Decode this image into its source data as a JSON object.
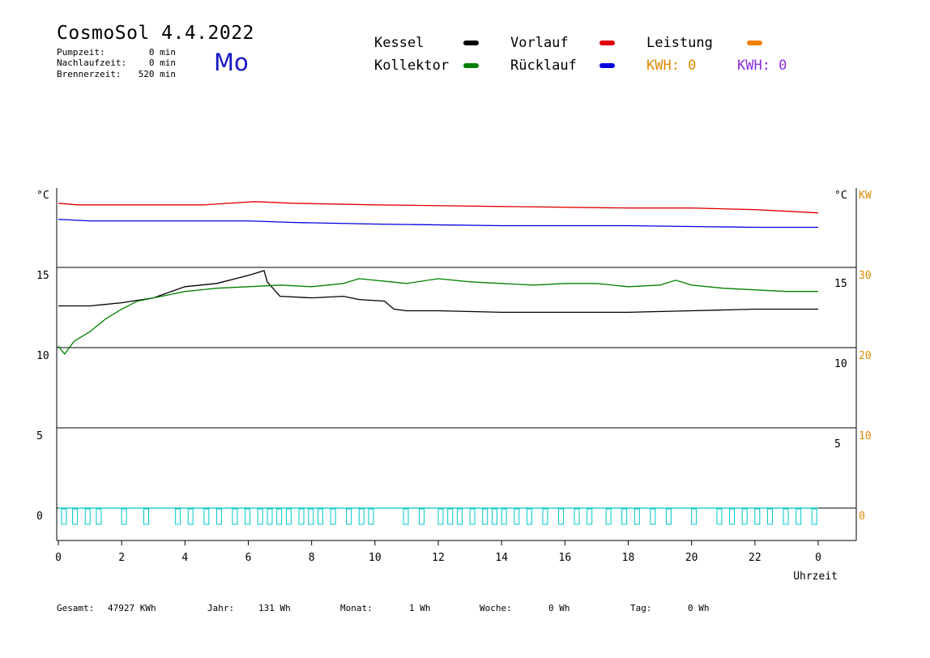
{
  "header": {
    "title": "CosmoSol 4.4.2022",
    "day": "Mo",
    "info": [
      {
        "label": "Pumpzeit:",
        "value": "0 min"
      },
      {
        "label": "Nachlaufzeit:",
        "value": "0 min"
      },
      {
        "label": "Brennerzeit:",
        "value": "520 min"
      }
    ]
  },
  "legend": {
    "items": [
      {
        "label": "Kessel",
        "color": "#000000"
      },
      {
        "label": "Vorlauf",
        "color": "#e00000"
      },
      {
        "label": "Leistung",
        "color": "#f08000"
      },
      {
        "label": "Kollektor",
        "color": "#008000"
      },
      {
        "label": "Rücklauf",
        "color": "#0000e0"
      }
    ],
    "kwh_orange": "KWH: 0",
    "kwh_purple": "KWH: 0",
    "kwh_orange_color": "#e08a00",
    "kwh_purple_color": "#8a2be2"
  },
  "footer": {
    "items": [
      {
        "label": "Gesamt:",
        "value": "47927 KWh"
      },
      {
        "label": "Jahr:",
        "value": "131 Wh"
      },
      {
        "label": "Monat:",
        "value": "1 Wh"
      },
      {
        "label": "Woche:",
        "value": "0 Wh"
      },
      {
        "label": "Tag:",
        "value": "0 Wh"
      }
    ]
  },
  "chart_data": {
    "type": "line",
    "xlabel": "Uhrzeit",
    "x_ticks": [
      "0",
      "2",
      "4",
      "6",
      "8",
      "10",
      "12",
      "14",
      "16",
      "18",
      "20",
      "22",
      "0"
    ],
    "xlim": [
      0,
      24
    ],
    "left_axis": {
      "unit": "°C",
      "ticks": [
        "15",
        "10",
        "5",
        "0"
      ],
      "values": [
        15,
        10,
        5,
        0
      ]
    },
    "right_axis_c": {
      "unit": "°C",
      "ticks": [
        "15",
        "10",
        "5"
      ]
    },
    "right_axis_kw": {
      "unit": "KW",
      "ticks": [
        "30",
        "20",
        "10",
        "0"
      ],
      "color": "#e08a00"
    },
    "ylim": [
      -2,
      20
    ],
    "grid_y": [
      15,
      10,
      5,
      0
    ],
    "series": [
      {
        "name": "Vorlauf",
        "color": "#e00000",
        "x": [
          0,
          0.6,
          4.6,
          6.2,
          7.4,
          10,
          14,
          18,
          20,
          22,
          24
        ],
        "y": [
          19.0,
          18.9,
          18.9,
          19.1,
          19.0,
          18.9,
          18.8,
          18.7,
          18.7,
          18.6,
          18.4
        ]
      },
      {
        "name": "Rücklauf",
        "color": "#0000e0",
        "x": [
          0,
          1,
          3,
          6,
          7.5,
          10,
          14,
          18,
          22,
          24
        ],
        "y": [
          18.0,
          17.9,
          17.9,
          17.9,
          17.8,
          17.7,
          17.6,
          17.6,
          17.5,
          17.5
        ]
      },
      {
        "name": "Kessel",
        "color": "#000000",
        "x": [
          0,
          1,
          2,
          3,
          4,
          5,
          6,
          6.5,
          6.6,
          7,
          8,
          9,
          9.5,
          10.3,
          10.6,
          11,
          12,
          14,
          16,
          18,
          20,
          22,
          24
        ],
        "y": [
          12.6,
          12.6,
          12.8,
          13.1,
          13.8,
          14.0,
          14.5,
          14.8,
          14.1,
          13.2,
          13.1,
          13.2,
          13.0,
          12.9,
          12.4,
          12.3,
          12.3,
          12.2,
          12.2,
          12.2,
          12.3,
          12.4,
          12.4
        ]
      },
      {
        "name": "Kollektor",
        "color": "#008000",
        "x": [
          0,
          0.2,
          0.5,
          1,
          1.5,
          2,
          2.5,
          3,
          3.5,
          4,
          5,
          6,
          7,
          8,
          9,
          9.5,
          10.5,
          11,
          12,
          13,
          14,
          15,
          16,
          17,
          18,
          19,
          19.5,
          20,
          21,
          22,
          23,
          24
        ],
        "y": [
          10.1,
          9.6,
          10.4,
          11.0,
          11.8,
          12.4,
          12.9,
          13.1,
          13.3,
          13.5,
          13.7,
          13.8,
          13.9,
          13.8,
          14.0,
          14.3,
          14.1,
          14.0,
          14.3,
          14.1,
          14.0,
          13.9,
          14.0,
          14.0,
          13.8,
          13.9,
          14.2,
          13.9,
          13.7,
          13.6,
          13.5,
          13.5
        ]
      },
      {
        "name": "Leistung",
        "color": "#00c8c8",
        "x": [
          0,
          24
        ],
        "y": [
          0,
          0
        ]
      }
    ]
  }
}
